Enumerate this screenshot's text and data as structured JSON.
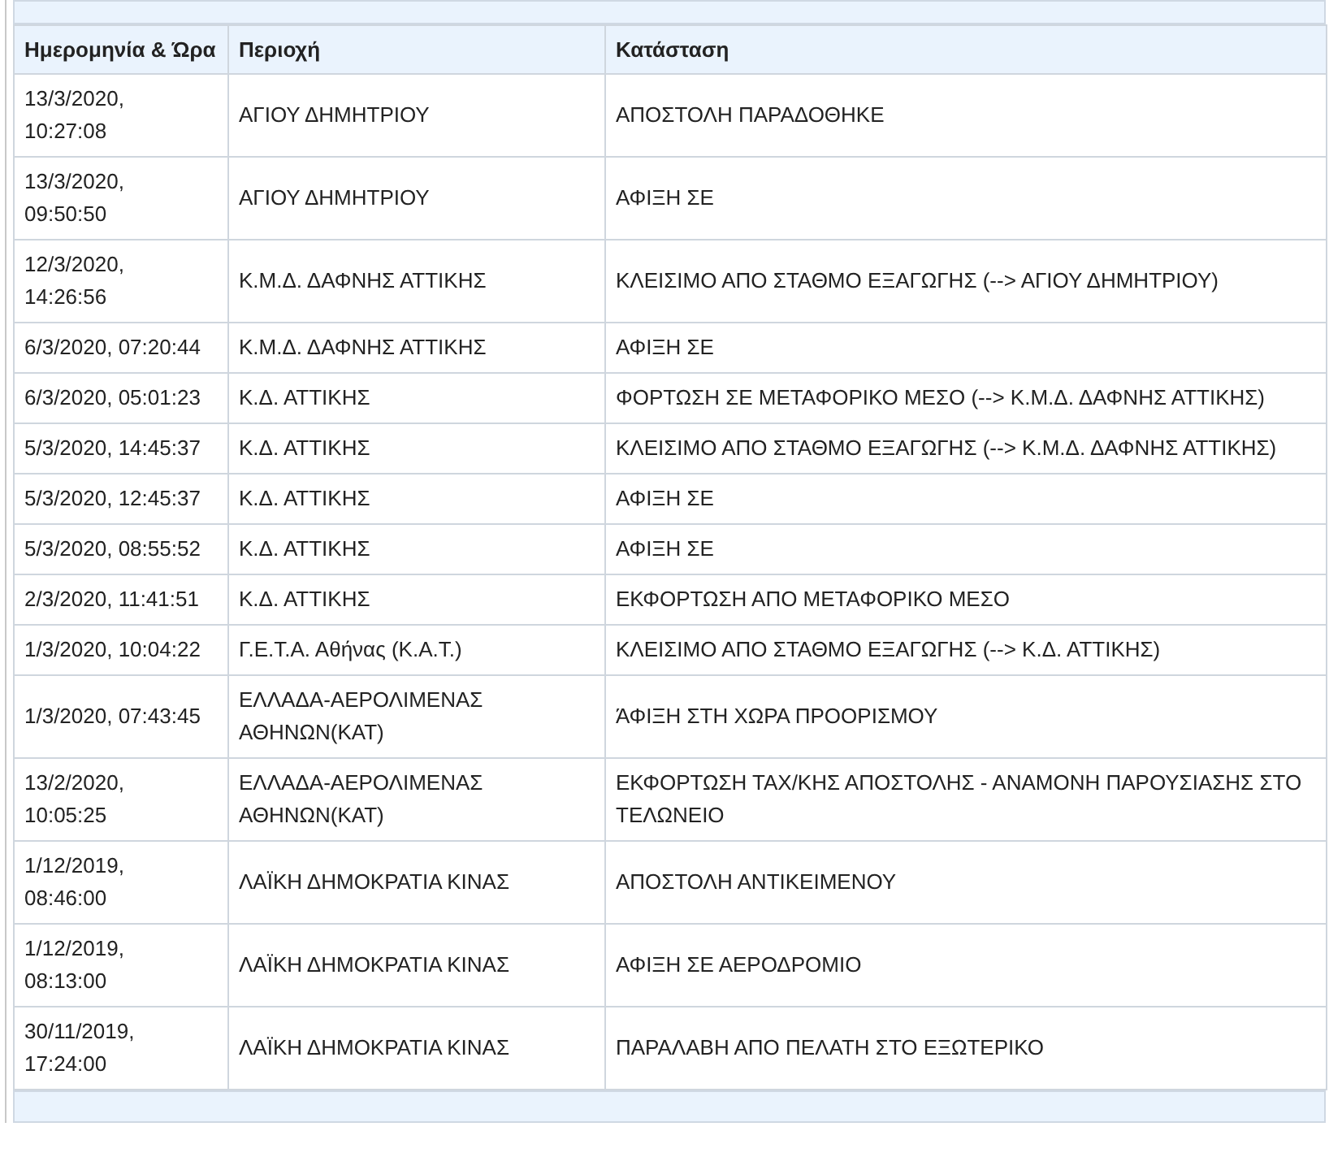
{
  "table": {
    "columns": [
      "Ημερομηνία & Ώρα",
      "Περιοχή",
      "Κατάσταση"
    ],
    "rows": [
      [
        "13/3/2020, 10:27:08",
        "ΑΓΙΟΥ ΔΗΜΗΤΡΙΟΥ",
        "ΑΠΟΣΤΟΛΗ ΠΑΡΑΔΟΘΗΚΕ"
      ],
      [
        "13/3/2020, 09:50:50",
        "ΑΓΙΟΥ ΔΗΜΗΤΡΙΟΥ",
        "ΑΦΙΞΗ ΣΕ"
      ],
      [
        "12/3/2020, 14:26:56",
        "Κ.Μ.Δ. ΔΑΦΝΗΣ ΑΤΤΙΚΗΣ",
        "ΚΛΕΙΣΙΜΟ ΑΠΟ ΣΤΑΘΜΟ ΕΞΑΓΩΓΗΣ (--> ΑΓΙΟΥ ΔΗΜΗΤΡΙΟΥ)"
      ],
      [
        "6/3/2020, 07:20:44",
        "Κ.Μ.Δ. ΔΑΦΝΗΣ ΑΤΤΙΚΗΣ",
        "ΑΦΙΞΗ ΣΕ"
      ],
      [
        "6/3/2020, 05:01:23",
        "Κ.Δ. ΑΤΤΙΚΗΣ",
        "ΦΟΡΤΩΣΗ ΣΕ ΜΕΤΑΦΟΡΙΚΟ ΜΕΣΟ (--> Κ.Μ.Δ. ΔΑΦΝΗΣ ΑΤΤΙΚΗΣ)"
      ],
      [
        "5/3/2020, 14:45:37",
        "Κ.Δ. ΑΤΤΙΚΗΣ",
        "ΚΛΕΙΣΙΜΟ ΑΠΟ ΣΤΑΘΜΟ ΕΞΑΓΩΓΗΣ (--> Κ.Μ.Δ. ΔΑΦΝΗΣ ΑΤΤΙΚΗΣ)"
      ],
      [
        "5/3/2020, 12:45:37",
        "Κ.Δ. ΑΤΤΙΚΗΣ",
        "ΑΦΙΞΗ ΣΕ"
      ],
      [
        "5/3/2020, 08:55:52",
        "Κ.Δ. ΑΤΤΙΚΗΣ",
        "ΑΦΙΞΗ ΣΕ"
      ],
      [
        "2/3/2020, 11:41:51",
        "Κ.Δ. ΑΤΤΙΚΗΣ",
        "ΕΚΦΟΡΤΩΣΗ ΑΠΟ ΜΕΤΑΦΟΡΙΚΟ ΜΕΣΟ"
      ],
      [
        "1/3/2020, 10:04:22",
        "Γ.Ε.Τ.Α. Αθήνας (Κ.Α.Τ.)",
        "ΚΛΕΙΣΙΜΟ ΑΠΟ ΣΤΑΘΜΟ ΕΞΑΓΩΓΗΣ (--> Κ.Δ. ΑΤΤΙΚΗΣ)"
      ],
      [
        "1/3/2020, 07:43:45",
        "ΕΛΛΑΔΑ-ΑΕΡΟΛΙΜΕΝΑΣ ΑΘΗΝΩΝ(ΚΑΤ)",
        "ΆΦΙΞΗ ΣΤΗ ΧΩΡΑ ΠΡΟΟΡΙΣΜΟΥ"
      ],
      [
        "13/2/2020, 10:05:25",
        "ΕΛΛΑΔΑ-ΑΕΡΟΛΙΜΕΝΑΣ ΑΘΗΝΩΝ(ΚΑΤ)",
        "ΕΚΦΟΡΤΩΣΗ ΤΑΧ/ΚΗΣ ΑΠΟΣΤΟΛΗΣ - ΑΝΑΜΟΝΗ ΠΑΡΟΥΣΙΑΣΗΣ ΣΤΟ ΤΕΛΩΝΕΙΟ"
      ],
      [
        "1/12/2019, 08:46:00",
        "ΛΑΪΚΗ ΔΗΜΟΚΡΑΤΙΑ ΚΙΝΑΣ",
        "ΑΠΟΣΤΟΛΗ ΑΝΤΙΚΕΙΜΕΝΟΥ"
      ],
      [
        "1/12/2019, 08:13:00",
        "ΛΑΪΚΗ ΔΗΜΟΚΡΑΤΙΑ ΚΙΝΑΣ",
        "ΑΦΙΞΗ ΣΕ ΑΕΡΟΔΡΟΜΙΟ"
      ],
      [
        "30/11/2019, 17:24:00",
        "ΛΑΪΚΗ ΔΗΜΟΚΡΑΤΙΑ ΚΙΝΑΣ",
        "ΠΑΡΑΛΑΒΗ ΑΠΟ ΠΕΛΑΤΗ ΣΤΟ ΕΞΩΤΕΡΙΚΟ"
      ]
    ]
  }
}
